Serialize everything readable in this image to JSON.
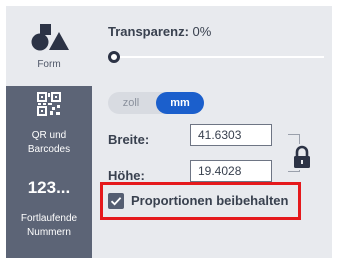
{
  "sidebar": {
    "items": [
      {
        "label": "Form",
        "icon": "shapes-icon"
      },
      {
        "label": "QR und Barcodes",
        "icon": "qr-code-icon"
      },
      {
        "label": "Fortlaufende Nummern",
        "icon": "numbers-icon",
        "glyph": "123..."
      }
    ]
  },
  "transparency": {
    "label": "Transparenz:",
    "value": "0%",
    "level": 0
  },
  "units": {
    "options": [
      "zoll",
      "mm"
    ],
    "selected": "mm"
  },
  "width": {
    "label": "Breite:",
    "value": "41.6303"
  },
  "height": {
    "label": "Höhe:",
    "value": "19.4028"
  },
  "proportions": {
    "label": "Proportionen beibehalten",
    "checked": true
  },
  "colors": {
    "accent": "#1b5fcc",
    "highlight": "#e5191c",
    "sidebar": "#5c6476"
  }
}
